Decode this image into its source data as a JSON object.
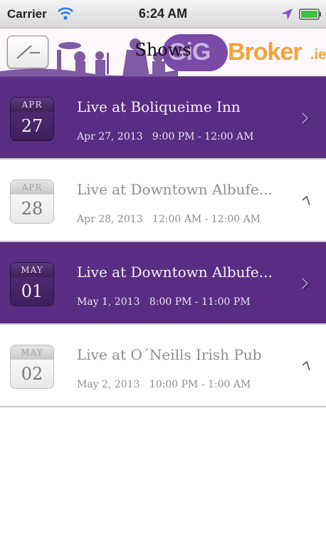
{
  "status_bar": {
    "carrier": "Carrier",
    "time": "6:24 AM"
  },
  "nav_bar": {
    "title": "Shows",
    "logo": {
      "gig": "GiG",
      "broker": "Broker",
      "ie": ".ie"
    }
  },
  "shows": [
    {
      "month": "APR",
      "day": "27",
      "title": "Live at Boliqueime Inn",
      "datetime": "Apr 27, 2013   9:00 PM - 12:00 AM",
      "highlighted": true
    },
    {
      "month": "APR",
      "day": "28",
      "title": "Live at Downtown Albufe...",
      "datetime": "Apr 28, 2013   12:00 AM - 12:00 AM",
      "highlighted": false
    },
    {
      "month": "MAY",
      "day": "01",
      "title": "Live at Downtown Albufe...",
      "datetime": "May 1, 2013   8:00 PM - 11:00 PM",
      "highlighted": true
    },
    {
      "month": "MAY",
      "day": "02",
      "title": "Live at O´Neills Irish Pub",
      "datetime": "May 2, 2013   10:00 PM - 1:00 AM",
      "highlighted": false
    }
  ],
  "colors": {
    "highlight": "#5b2d82",
    "accent_orange": "#f0a437"
  }
}
